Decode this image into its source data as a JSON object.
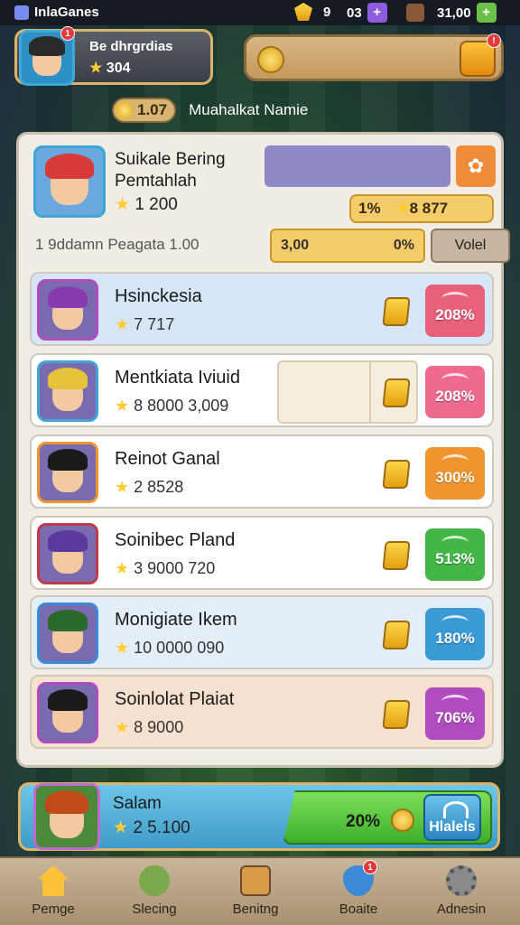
{
  "status_bar": {
    "app_name": "InlaGanes",
    "gold_count": "9",
    "gems_count": "03",
    "money": "31,00"
  },
  "player": {
    "name": "Be dhrgrdias",
    "badge": "1",
    "rating": "304"
  },
  "sub_header": {
    "coin_value": "1.07",
    "title": "Muahalkat Namie"
  },
  "selected": {
    "title": "Suikale Bering Pemtahlah",
    "rating": "1 200",
    "gold_amount": "1%",
    "gold_bonus": "8 877",
    "stats_text": "1 9ddamn Peagata 1.00",
    "stat_value": "3,00",
    "stat_pct": "0%",
    "action_label": "Volel"
  },
  "rows": [
    {
      "name": "Hsinckesia",
      "stats": "7 717",
      "pct": "208%",
      "color": "#e8607a",
      "bg": "#d6e6f7"
    },
    {
      "name": "Mentkiata Iviuid",
      "stats": "8 8000 3,009",
      "pct": "208%",
      "color": "#ee6a8e",
      "bg": "#ffffff"
    },
    {
      "name": "Reinot Ganal",
      "stats": "2 8528",
      "pct": "300%",
      "color": "#f0952e",
      "bg": "#ffffff"
    },
    {
      "name": "Soinibec Pland",
      "stats": "3 9000 720",
      "pct": "513%",
      "color": "#42b646",
      "bg": "#ffffff"
    },
    {
      "name": "Monigiate Ikem",
      "stats": "10 0000 090",
      "pct": "180%",
      "color": "#3a9ad6",
      "bg": "#e4eef6"
    },
    {
      "name": "Soinlolat Plaiat",
      "stats": "8 9000",
      "pct": "706%",
      "color": "#b04cc0",
      "bg": "#f6e0cf"
    }
  ],
  "bottom_player": {
    "name": "Salam",
    "stats": "2 5.100",
    "pct": "20%",
    "action": "Hlalels"
  },
  "nav": [
    {
      "label": "Pemge",
      "icon": "home-icon"
    },
    {
      "label": "Slecing",
      "icon": "shield-icon"
    },
    {
      "label": "Benitng",
      "icon": "cards-icon"
    },
    {
      "label": "Boaite",
      "icon": "gem-icon"
    },
    {
      "label": "Adnesin",
      "icon": "gear-icon"
    }
  ]
}
